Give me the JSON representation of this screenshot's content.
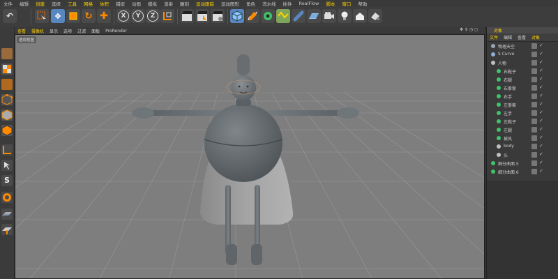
{
  "menu": {
    "items": [
      {
        "label": "文件"
      },
      {
        "label": "编辑"
      },
      {
        "label": "创建",
        "hl": true
      },
      {
        "label": "选择"
      },
      {
        "label": "工具",
        "hl": true
      },
      {
        "label": "网格",
        "hl": true
      },
      {
        "label": "体积",
        "hl": true
      },
      {
        "label": "捕捉"
      },
      {
        "label": "动画"
      },
      {
        "label": "模拟"
      },
      {
        "label": "渲染"
      },
      {
        "label": "雕刻"
      },
      {
        "label": "运动跟踪",
        "hl": true
      },
      {
        "label": "运动图形"
      },
      {
        "label": "角色"
      },
      {
        "label": "流水线"
      },
      {
        "label": "插件"
      },
      {
        "label": "RealFlow"
      },
      {
        "label": "脚本",
        "hl": true
      },
      {
        "label": "窗口",
        "hl": true
      },
      {
        "label": "帮助"
      }
    ]
  },
  "toolbar": {
    "undo_icon": "undo-icon",
    "x_label": "X",
    "y_label": "Y",
    "z_label": "Z"
  },
  "viewport": {
    "menu_items": [
      {
        "label": "查看",
        "hl": true
      },
      {
        "label": "摄像机",
        "hl": true
      },
      {
        "label": "显示"
      },
      {
        "label": "选项"
      },
      {
        "label": "过滤"
      },
      {
        "label": "面板"
      },
      {
        "label": "ProRender"
      }
    ],
    "nav_icons": "✥ ⇕ ◷ ◻",
    "view_label": "透视视图"
  },
  "objects_panel": {
    "title": "对象",
    "menu": [
      {
        "label": "文件",
        "hl": true
      },
      {
        "label": "编辑"
      },
      {
        "label": "查看"
      },
      {
        "label": "对象",
        "hl": true
      }
    ],
    "items": [
      {
        "name": "物理天空",
        "indent": 0,
        "icon": "#9aa5b5"
      },
      {
        "name": "S Curve",
        "indent": 0,
        "icon": "#8fb0d8"
      },
      {
        "name": "人物",
        "indent": 0,
        "icon": "#c0c0c0"
      },
      {
        "name": "右鞋子",
        "indent": 1,
        "icon": "#3fc46a"
      },
      {
        "name": "右腿",
        "indent": 1,
        "icon": "#3fc46a"
      },
      {
        "name": "右拳套",
        "indent": 1,
        "icon": "#3fc46a"
      },
      {
        "name": "右手",
        "indent": 1,
        "icon": "#3fc46a"
      },
      {
        "name": "左拳套",
        "indent": 1,
        "icon": "#3fc46a"
      },
      {
        "name": "左手",
        "indent": 1,
        "icon": "#3fc46a"
      },
      {
        "name": "左鞋子",
        "indent": 1,
        "icon": "#3fc46a"
      },
      {
        "name": "左腿",
        "indent": 1,
        "icon": "#3fc46a"
      },
      {
        "name": "披风",
        "indent": 1,
        "icon": "#3fc46a"
      },
      {
        "name": "body",
        "indent": 1,
        "icon": "#c0c0c0"
      },
      {
        "name": "头",
        "indent": 1,
        "icon": "#c0c0c0"
      },
      {
        "name": "细分曲面.5",
        "indent": 0,
        "icon": "#3fc46a"
      },
      {
        "name": "细分曲面.6",
        "indent": 0,
        "icon": "#3fc46a"
      }
    ]
  },
  "colors": {
    "accent": "#ffd200",
    "viewport_bg": "#7d7d7d",
    "panel_bg": "#3a3a3a"
  }
}
